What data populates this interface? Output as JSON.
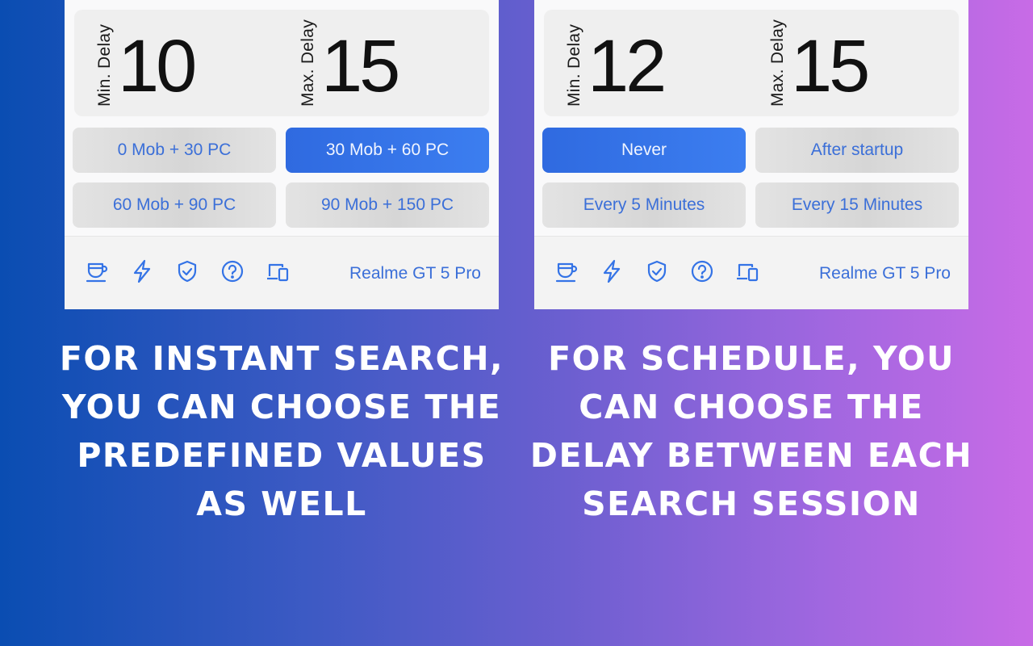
{
  "left_panel": {
    "min_delay_label": "Min. Delay",
    "min_delay_value": "10",
    "max_delay_label": "Max. Delay",
    "max_delay_value": "15",
    "options": [
      "0 Mob + 30 PC",
      "30 Mob + 60 PC",
      "60 Mob + 90 PC",
      "90 Mob + 150 PC"
    ],
    "selected_option": "30 Mob + 60 PC",
    "device": "Realme GT 5 Pro"
  },
  "right_panel": {
    "min_delay_label": "Min. Delay",
    "min_delay_value": "12",
    "max_delay_label": "Max. Delay",
    "max_delay_value": "15",
    "options": [
      "Never",
      "After startup",
      "Every 5 Minutes",
      "Every 15 Minutes"
    ],
    "selected_option": "Never",
    "device": "Realme GT 5 Pro"
  },
  "footer_icons": [
    "cup-icon",
    "lightning-icon",
    "shield-check-icon",
    "help-circle-icon",
    "devices-icon"
  ],
  "captions": {
    "left": "For instant search, you can choose the predefined values as well",
    "right": "For schedule, you can choose the delay between each search session"
  },
  "colors": {
    "accent": "#3473e6",
    "background_start": "#0a4db2",
    "background_end": "#c86be6"
  }
}
